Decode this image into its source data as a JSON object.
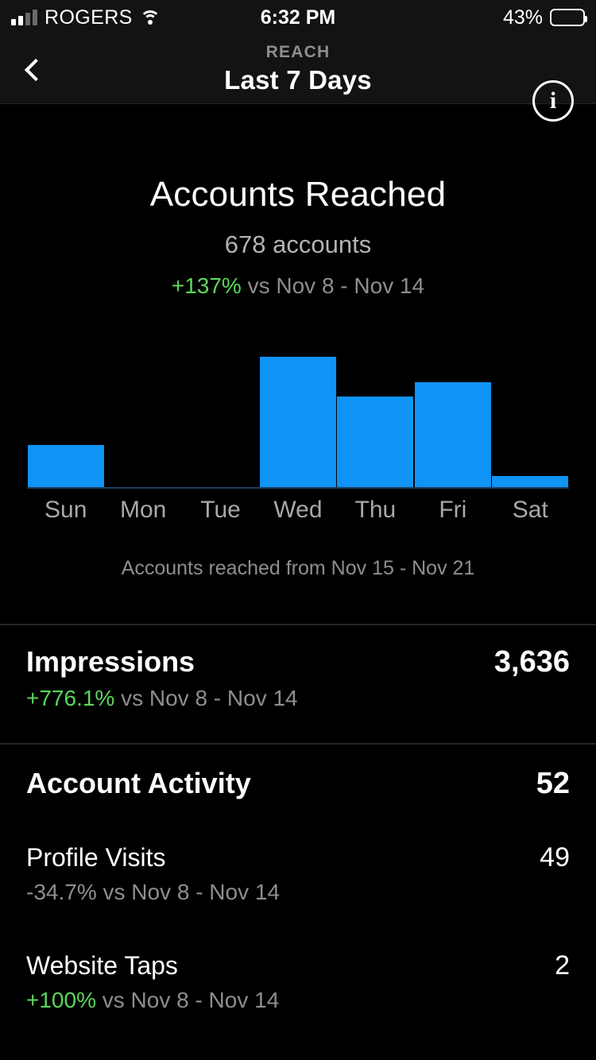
{
  "status_bar": {
    "carrier": "ROGERS",
    "time": "6:32 PM",
    "battery_percent": "43%",
    "battery_level": 43,
    "signal_icon": "cellular-signal-icon",
    "wifi_icon": "wifi-icon",
    "battery_icon": "battery-icon"
  },
  "nav": {
    "back_icon": "chevron-left-icon",
    "eyebrow": "REACH",
    "title": "Last 7 Days",
    "info_icon": "info-icon",
    "info_glyph": "i"
  },
  "hero": {
    "title": "Accounts Reached",
    "subtitle": "678 accounts",
    "delta_value": "+137%",
    "delta_rest": " vs Nov 8 - Nov 14",
    "delta_color": "#5bd75b"
  },
  "chart_caption": "Accounts reached from Nov 15 - Nov 21",
  "chart_data": {
    "type": "bar",
    "title": "Accounts Reached",
    "categories": [
      "Sun",
      "Mon",
      "Tue",
      "Wed",
      "Thu",
      "Fri",
      "Sat"
    ],
    "values": [
      75,
      1,
      1,
      225,
      158,
      182,
      22
    ],
    "xlabel": "",
    "ylabel": "",
    "ylim": [
      0,
      235
    ],
    "grid": false,
    "legend": "none",
    "bar_color": "#0f93f5",
    "axis_color": "#1c3d5c",
    "total_label": "678 accounts",
    "date_range": "Nov 15 - Nov 21",
    "comparison_range": "Nov 8 - Nov 14",
    "comparison_delta": "+137%"
  },
  "metrics": [
    {
      "name": "Impressions",
      "value": "3,636",
      "delta_value": "+776.1%",
      "delta_rest": " vs Nov 8 - Nov 14",
      "delta_color": "#5bd75b"
    },
    {
      "name": "Account Activity",
      "value": "52",
      "delta_value": "",
      "delta_rest": "",
      "delta_color": "#8e8e8e"
    },
    {
      "name": "Profile Visits",
      "value": "49",
      "delta_value": "-34.7%",
      "delta_rest": " vs Nov 8 - Nov 14",
      "delta_color": "#8e8e8e"
    },
    {
      "name": "Website Taps",
      "value": "2",
      "delta_value": "+100%",
      "delta_rest": " vs Nov 8 - Nov 14",
      "delta_color": "#5bd75b"
    }
  ]
}
